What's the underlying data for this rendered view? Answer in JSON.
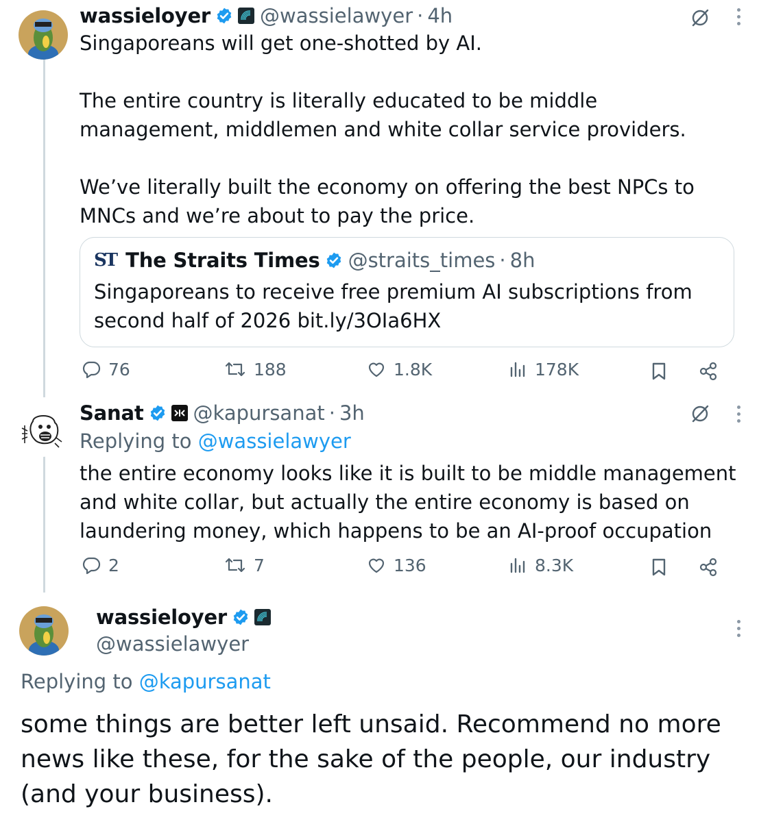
{
  "tweet1": {
    "name": "wassieloyer",
    "handle": "@wassielawyer",
    "time": "4h",
    "text": "Singaporeans will get one-shotted by AI.\n\nThe entire country is literally educated to be middle\nmanagement, middlemen and white collar service providers.\n\nWe’ve literally built the economy on offering the best NPCs to\nMNCs and we’re about to pay the price.",
    "quote": {
      "logo": "ST",
      "name": "The Straits Times",
      "handle": "@straits_times",
      "time": "8h",
      "text": "Singaporeans to receive free premium AI subscriptions from\nsecond half of 2026 bit.ly/3OIa6HX"
    },
    "stats": {
      "replies": "76",
      "reposts": "188",
      "likes": "1.8K",
      "views": "178K"
    }
  },
  "tweet2": {
    "name": "Sanat",
    "handle": "@kapursanat",
    "time": "3h",
    "replying_prefix": "Replying to ",
    "replying_to": "@wassielawyer",
    "text": "the entire economy looks like it is built to be middle management\nand white collar, but actually the entire economy is based on\nlaundering money, which happens to be an AI-proof occupation",
    "stats": {
      "replies": "2",
      "reposts": "7",
      "likes": "136",
      "views": "8.3K"
    }
  },
  "tweet3": {
    "name": "wassieloyer",
    "handle": "@wassielawyer",
    "replying_prefix": "Replying to ",
    "replying_to": "@kapursanat",
    "text": "some things are better left unsaid. Recommend no more\nnews like these, for the sake of the people, our industry\n(and your business)."
  },
  "colors": {
    "accent": "#1d9bf0",
    "secondary": "#536471",
    "text": "#0f1419",
    "border": "#cfd9de"
  }
}
